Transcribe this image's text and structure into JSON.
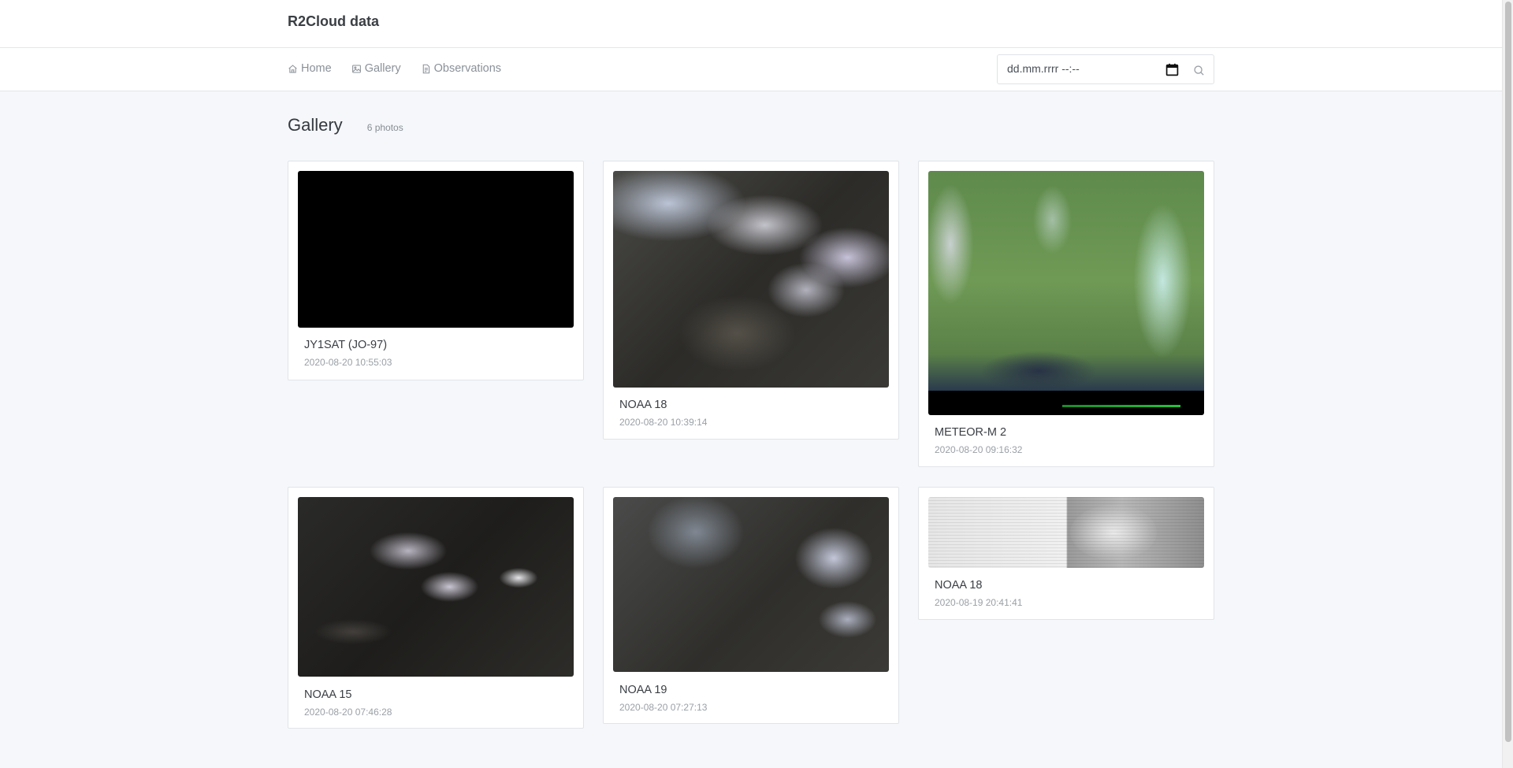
{
  "app": {
    "brand": "R2Cloud data"
  },
  "nav": {
    "items": [
      {
        "label": "Home",
        "icon": "home-icon"
      },
      {
        "label": "Gallery",
        "icon": "image-icon"
      },
      {
        "label": "Observations",
        "icon": "document-icon"
      }
    ],
    "date_filter": {
      "placeholder": "dd.mm.rrrr --:--"
    }
  },
  "main": {
    "title": "Gallery",
    "photo_count": "6 photos",
    "photos": [
      {
        "satellite": "JY1SAT (JO-97)",
        "timestamp": "2020-08-20 10:55:03"
      },
      {
        "satellite": "NOAA 18",
        "timestamp": "2020-08-20 10:39:14"
      },
      {
        "satellite": "METEOR-M 2",
        "timestamp": "2020-08-20 09:16:32"
      },
      {
        "satellite": "NOAA 15",
        "timestamp": "2020-08-20 07:46:28"
      },
      {
        "satellite": "NOAA 19",
        "timestamp": "2020-08-20 07:27:13"
      },
      {
        "satellite": "NOAA 18",
        "timestamp": "2020-08-19 20:41:41"
      }
    ]
  },
  "colors": {
    "background": "#f5f7fa",
    "nav_text": "#8a9199",
    "title_text": "#343a40"
  }
}
